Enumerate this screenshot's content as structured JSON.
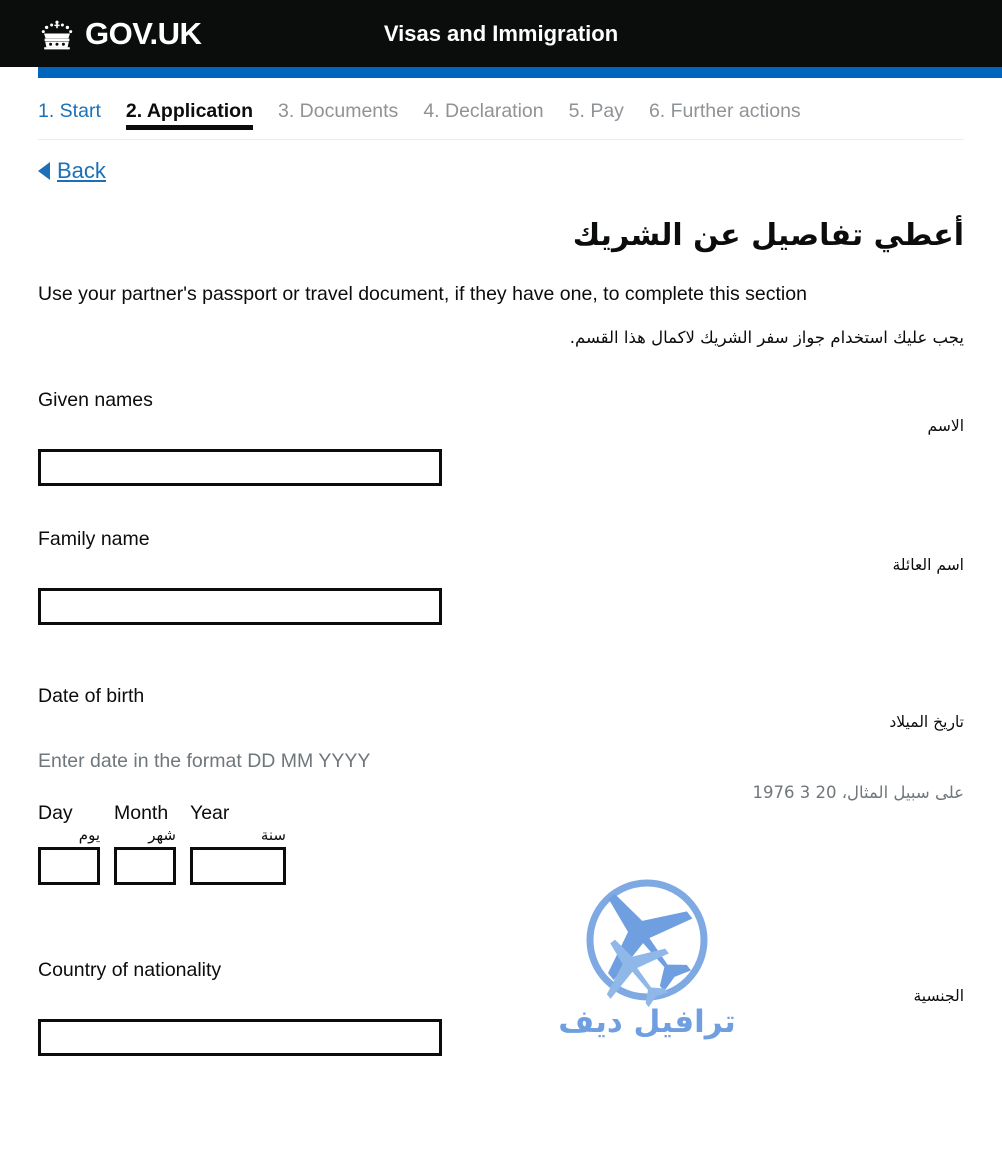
{
  "header": {
    "brand": "GOV.UK",
    "crown_icon": "crown-icon",
    "service_name": "Visas and Immigration",
    "accent_black": "#0b0c0c",
    "accent_blue": "#0065bd"
  },
  "phase_nav": {
    "tabs": [
      {
        "label": "1. Start",
        "state": "link"
      },
      {
        "label": "2. Application",
        "state": "current"
      },
      {
        "label": "3. Documents",
        "state": "done"
      },
      {
        "label": "4. Declaration",
        "state": "done"
      },
      {
        "label": "5. Pay",
        "state": "done"
      },
      {
        "label": "6. Further actions",
        "state": "done"
      }
    ]
  },
  "back_link": {
    "label": "Back",
    "icon": "back-arrow-icon"
  },
  "page": {
    "heading_ar": "أعطي تفاصيل عن الشريك",
    "intro_en": "Use your partner's passport or travel document, if they have one, to complete this section",
    "intro_ar": "يجب عليك استخدام جواز سفر الشريك لاكمال هذا القسم."
  },
  "fields": {
    "given_names": {
      "label_en": "Given names",
      "label_ar": "الاسم",
      "value": ""
    },
    "family_name": {
      "label_en": "Family name",
      "label_ar": "اسم العائلة",
      "value": ""
    },
    "date_of_birth": {
      "label_en": "Date of birth",
      "label_ar": "تاريخ الميلاد",
      "hint_en": "Enter date in the format DD MM YYYY",
      "hint_ar": "على سبيل المثال، 20 3 1976",
      "day": {
        "label_en": "Day",
        "label_ar": "يوم",
        "value": ""
      },
      "month": {
        "label_en": "Month",
        "label_ar": "شهر",
        "value": ""
      },
      "year": {
        "label_en": "Year",
        "label_ar": "سنة",
        "value": ""
      }
    },
    "country_of_nationality": {
      "label_en": "Country of nationality",
      "label_ar": "الجنسية",
      "value": ""
    }
  },
  "watermark": {
    "text": "ترافيل ديف",
    "icon": "airplane-in-circle-icon",
    "color": "#6f9fe0"
  }
}
